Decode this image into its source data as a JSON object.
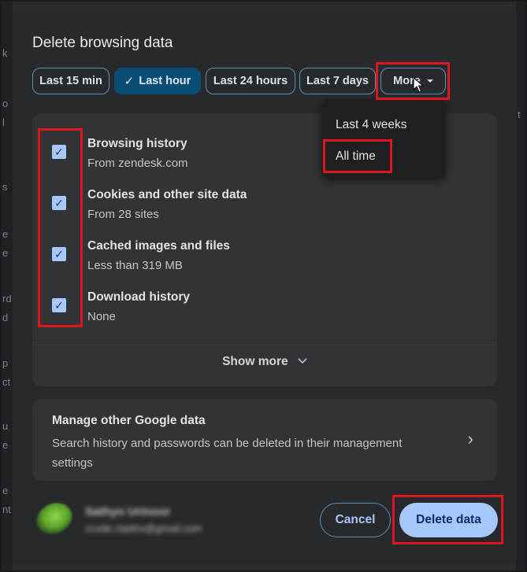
{
  "background": {
    "left_fragments": [
      "k",
      "o",
      "l",
      "s",
      "e",
      "e",
      "rd",
      "d",
      "p",
      "ct",
      "u",
      "e",
      "e",
      "nt"
    ],
    "right_fragment": "t"
  },
  "dialog": {
    "title": "Delete browsing data",
    "time_ranges": [
      {
        "label": "Last 15 min",
        "selected": false
      },
      {
        "label": "Last hour",
        "selected": true
      },
      {
        "label": "Last 24 hours",
        "selected": false
      },
      {
        "label": "Last 7 days",
        "selected": false
      },
      {
        "label": "More",
        "selected": false
      }
    ],
    "selected_check": "✓",
    "more_menu": {
      "items": [
        "Last 4 weeks",
        "All time"
      ]
    },
    "data_types": [
      {
        "title": "Browsing history",
        "subtitle": "From zendesk.com",
        "checked": true
      },
      {
        "title": "Cookies and other site data",
        "subtitle": "From 28 sites",
        "checked": true
      },
      {
        "title": "Cached images and files",
        "subtitle": "Less than 319 MB",
        "checked": true
      },
      {
        "title": "Download history",
        "subtitle": "None",
        "checked": true
      }
    ],
    "checkmark": "✓",
    "show_more_label": "Show more",
    "show_more_chevron": "chevron-down-icon",
    "manage": {
      "title": "Manage other Google data",
      "description": "Search history and passwords can be deleted in their management settings",
      "arrow": "›"
    },
    "account": {
      "name": "Sathyo Urinoor",
      "email": "ccvde.ctadnv@gmail.com"
    },
    "cancel_label": "Cancel",
    "delete_label": "Delete data"
  },
  "colors": {
    "highlight": "#e0161f",
    "accent": "#a8c7fa",
    "selected_chip": "#0a4c74"
  }
}
